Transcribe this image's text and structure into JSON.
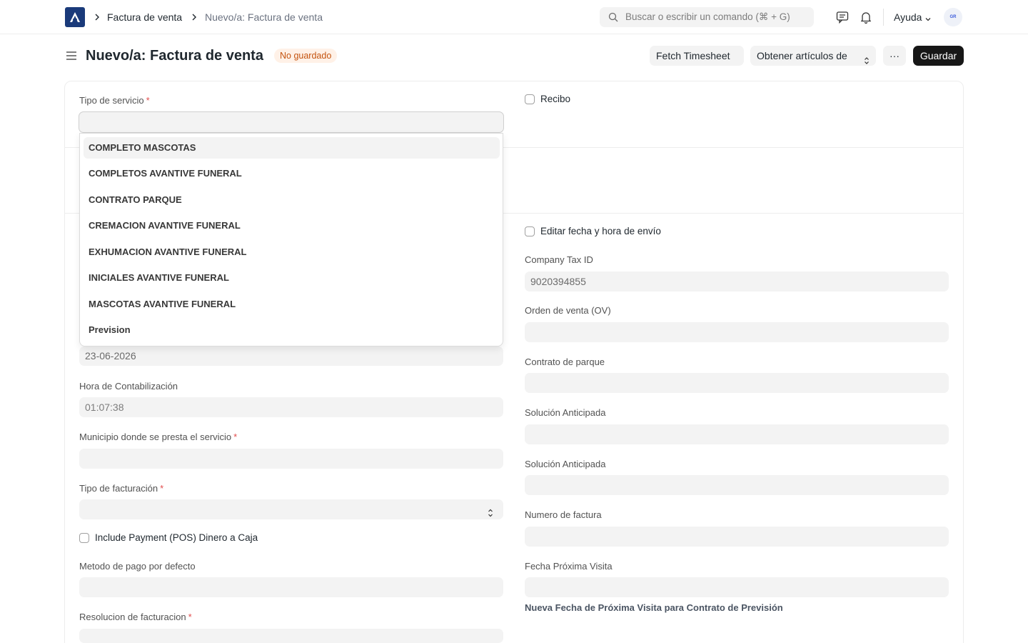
{
  "navbar": {
    "breadcrumbs": [
      "Factura de venta",
      "Nuevo/a: Factura de venta"
    ],
    "search_placeholder": "Buscar o escribir un comando (⌘ + G)",
    "help_label": "Ayuda",
    "avatar_text": "GR"
  },
  "page": {
    "title": "Nuevo/a: Factura de venta",
    "status_badge": "No guardado",
    "buttons": {
      "fetch_timesheet": "Fetch Timesheet",
      "get_items_from": "Obtener artículos de",
      "more": "···",
      "save": "Guardar"
    }
  },
  "form": {
    "service_type": {
      "label": "Tipo de servicio",
      "value": "",
      "options": [
        "COMPLETO MASCOTAS",
        "COMPLETOS AVANTIVE FUNERAL",
        "CONTRATO PARQUE",
        "CREMACION AVANTIVE FUNERAL",
        "EXHUMACION AVANTIVE FUNERAL",
        "INICIALES AVANTIVE FUNERAL",
        "MASCOTAS AVANTIVE FUNERAL",
        "Prevision"
      ]
    },
    "receipt_label": "Recibo",
    "posting_date_value": "23-06-2026",
    "posting_time": {
      "label": "Hora de Contabilización",
      "value": "01:07:38"
    },
    "municipality": {
      "label": "Municipio donde se presta el servicio",
      "value": ""
    },
    "billing_type": {
      "label": "Tipo de facturación",
      "value": ""
    },
    "include_payment_label": "Include Payment (POS) Dinero a Caja",
    "default_payment_method": {
      "label": "Metodo de pago por defecto",
      "value": ""
    },
    "billing_resolution": {
      "label": "Resolucion de facturacion",
      "value": ""
    },
    "edit_posting_label": "Editar fecha y hora de envío",
    "company_tax_id": {
      "label": "Company Tax ID",
      "value": "9020394855"
    },
    "sales_order": {
      "label": "Orden de venta (OV)",
      "value": ""
    },
    "park_contract": {
      "label": "Contrato de parque",
      "value": ""
    },
    "advance_solution_1": {
      "label": "Solución Anticipada",
      "value": ""
    },
    "advance_solution_2": {
      "label": "Solución Anticipada",
      "value": ""
    },
    "invoice_number": {
      "label": "Numero de factura",
      "value": ""
    },
    "next_visit_date": {
      "label": "Fecha Próxima Visita",
      "value": ""
    },
    "next_visit_note": "Nueva Fecha de Próxima Visita para Contrato de Previsión"
  }
}
